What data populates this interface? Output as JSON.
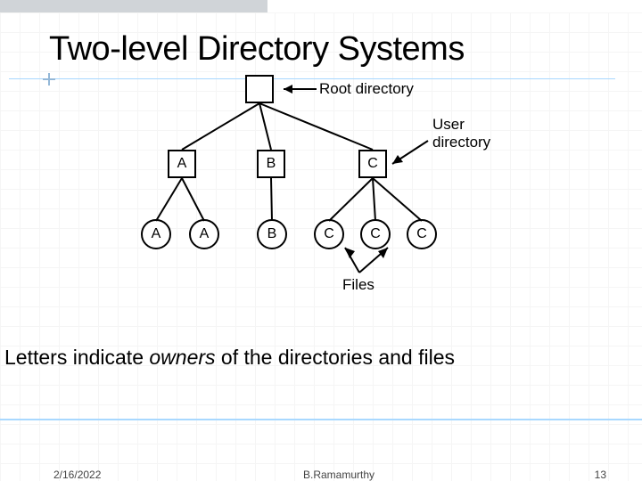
{
  "slide": {
    "title": "Two-level Directory Systems",
    "caption_pre": "Letters indicate ",
    "caption_em": "owners",
    "caption_post": " of the directories and files"
  },
  "labels": {
    "root": "Root directory",
    "user": "User directory",
    "files": "Files"
  },
  "tree": {
    "level1_boxes": [
      "A",
      "B",
      "C"
    ],
    "level2_circles": [
      "A",
      "A",
      "B",
      "C",
      "C",
      "C"
    ]
  },
  "footer": {
    "date": "2/16/2022",
    "author": "B.Ramamurthy",
    "page": "13"
  },
  "chart_data": {
    "type": "tree",
    "title": "Two-level Directory Systems",
    "root": {
      "name": "",
      "label": "Root directory",
      "shape": "box"
    },
    "children": [
      {
        "name": "A",
        "label": "User directory",
        "shape": "box",
        "children": [
          {
            "name": "A",
            "label": "File",
            "shape": "circle"
          },
          {
            "name": "A",
            "label": "File",
            "shape": "circle"
          }
        ]
      },
      {
        "name": "B",
        "label": "User directory",
        "shape": "box",
        "children": [
          {
            "name": "B",
            "label": "File",
            "shape": "circle"
          }
        ]
      },
      {
        "name": "C",
        "label": "User directory",
        "shape": "box",
        "children": [
          {
            "name": "C",
            "label": "File",
            "shape": "circle"
          },
          {
            "name": "C",
            "label": "File",
            "shape": "circle"
          },
          {
            "name": "C",
            "label": "File",
            "shape": "circle"
          }
        ]
      }
    ],
    "annotations": [
      "Root directory",
      "User directory",
      "Files"
    ]
  }
}
